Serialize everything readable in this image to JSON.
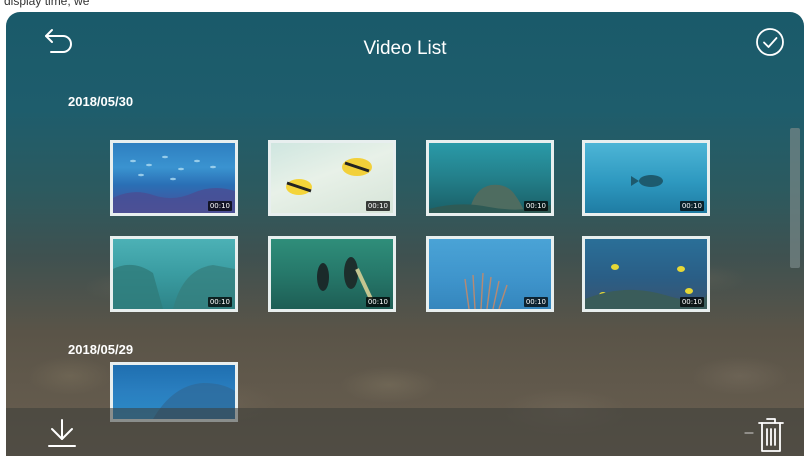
{
  "header": {
    "title": "Video List"
  },
  "groups": [
    {
      "date": "2018/05/30",
      "videos": [
        {
          "duration": "00:10",
          "scene": "reef-fish"
        },
        {
          "duration": "00:10",
          "scene": "butterflyfish-sand"
        },
        {
          "duration": "00:10",
          "scene": "coral-rock"
        },
        {
          "duration": "00:10",
          "scene": "single-fish-blue"
        },
        {
          "duration": "00:10",
          "scene": "reef-wall"
        },
        {
          "duration": "00:10",
          "scene": "divers"
        },
        {
          "duration": "00:10",
          "scene": "sea-fan"
        },
        {
          "duration": "00:10",
          "scene": "tropical-fish-reef"
        }
      ]
    },
    {
      "date": "2018/05/29",
      "videos": [
        {
          "duration": "",
          "scene": "reef-partial"
        }
      ]
    }
  ],
  "icons": {
    "back": "back-arrow-icon",
    "confirm": "check-circle-icon",
    "download": "download-icon",
    "delete": "trash-icon"
  },
  "colors": {
    "text": "#ffffff",
    "thumb_border": "#e8efef"
  }
}
